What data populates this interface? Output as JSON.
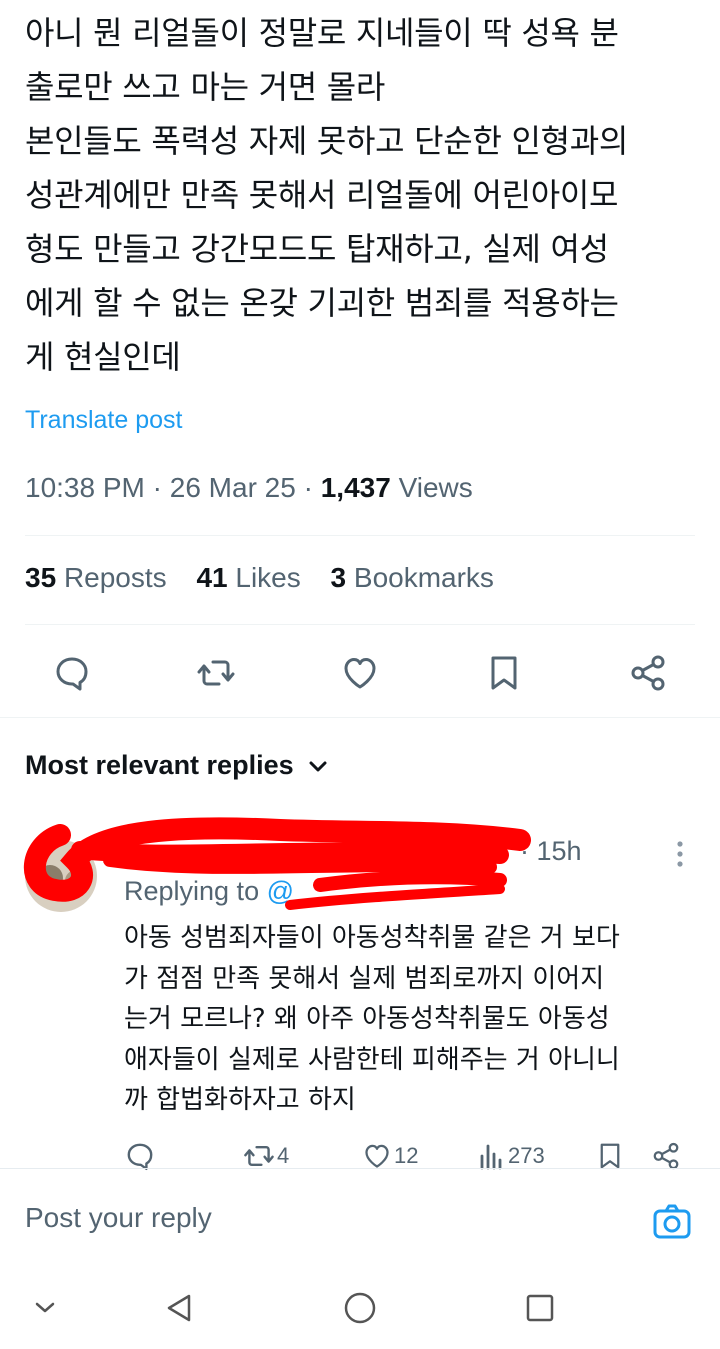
{
  "post": {
    "lines": [
      "아니 뭔 리얼돌이 정말로 지네들이 딱 성욕 분",
      "출로만 쓰고 마는 거면 몰라",
      "본인들도 폭력성 자제 못하고 단순한 인형과의",
      "성관계에만 만족 못해서 리얼돌에 어린아이모",
      "형도 만들고 강간모드도 탑재하고, 실제 여성",
      "에게 할 수 없는 온갖 기괴한 범죄를 적용하는",
      "게 현실인데"
    ],
    "translate": "Translate post",
    "time": "10:38 PM",
    "date": "26 Mar 25",
    "views_count": "1,437",
    "views_label": "Views",
    "sep": "·",
    "reposts_count": "35",
    "reposts_label": "Reposts",
    "likes_count": "41",
    "likes_label": "Likes",
    "bookmarks_count": "3",
    "bookmarks_label": "Bookmarks"
  },
  "replies_header": "Most relevant replies",
  "reply": {
    "time": "· 15h",
    "replying_prefix": "Replying to",
    "handle": "@",
    "lines": [
      "아동 성범죄자들이 아동성착취물 같은 거 보다",
      "가 점점 만족 못해서 실제 범죄로까지 이어지",
      "는거 모르나? 왜 아주 아동성착취물도 아동성",
      "애자들이 실제로 사람한테 피해주는 거 아니니",
      "까 합법화하자고 하지"
    ],
    "reposts": "4",
    "likes": "12",
    "views": "273"
  },
  "compose": {
    "placeholder": "Post your reply"
  },
  "icons": {
    "accent": "#1d9bf0",
    "muted": "#536471",
    "redaction": "#ff0000"
  }
}
